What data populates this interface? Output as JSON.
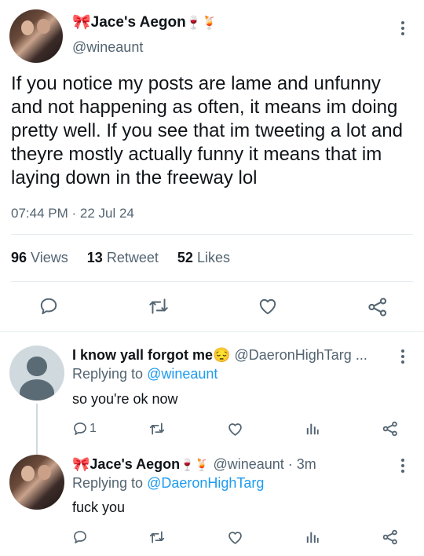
{
  "tweet": {
    "author_emoji": "🎀",
    "author_name": "Jace's Aegon",
    "author_suffix": "🍷🍹",
    "handle": "@wineaunt",
    "text": "If you notice my posts are lame and unfunny and not happening as often, it means im doing pretty well. If you see that im tweeting a lot and theyre mostly actually funny it means that im laying down in the freeway lol",
    "timestamp": "07:44 PM · 22 Jul 24",
    "stats": {
      "views_count": "96",
      "views_label": "Views",
      "retweets_count": "13",
      "retweets_label": "Retweet",
      "likes_count": "52",
      "likes_label": "Likes"
    }
  },
  "replies": [
    {
      "author_name": "I know yall forgot me",
      "author_suffix": "😔",
      "handle": "@DaeronHighTarg ...",
      "replying_prefix": "Replying to",
      "replying_to": "@wineaunt",
      "text": "so you're ok now",
      "reply_count": "1"
    },
    {
      "author_emoji": "🎀",
      "author_name": "Jace's Aegon",
      "author_suffix": "🍷🍹",
      "handle_time": "@wineaunt · 3m",
      "replying_prefix": "Replying to",
      "replying_to": "@DaeronHighTarg",
      "text": "fuck you"
    }
  ],
  "icons": [
    "reply-icon",
    "retweet-icon",
    "like-icon",
    "share-icon",
    "views-icon",
    "more-icon"
  ],
  "colors": {
    "link": "#1d9bf0",
    "muted": "#536471",
    "text": "#0f1419",
    "divider": "#e6ecf0"
  }
}
